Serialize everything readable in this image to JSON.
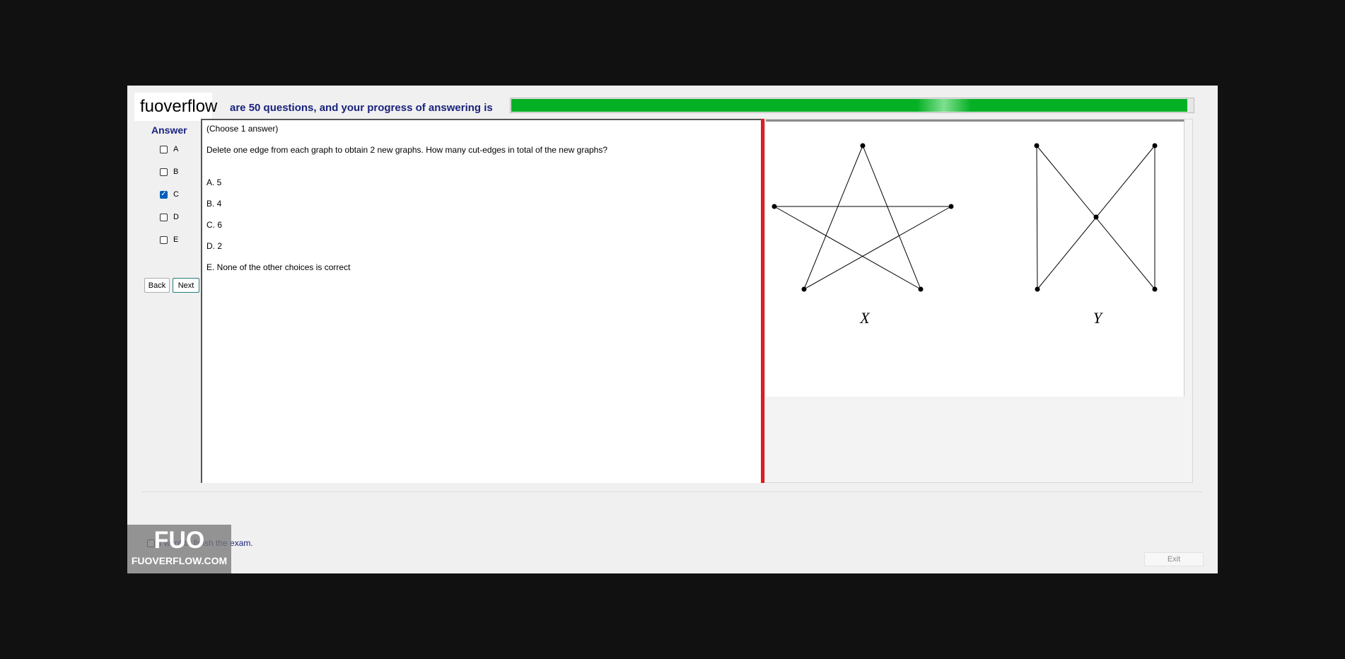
{
  "brand": {
    "logo_text": "fuoverflow"
  },
  "header": {
    "progress_text": "are 50 questions, and your progress of answering is",
    "progress_fraction": 0.99
  },
  "answer_panel": {
    "title": "Answer",
    "choices": [
      {
        "label": "A",
        "checked": false
      },
      {
        "label": "B",
        "checked": false
      },
      {
        "label": "C",
        "checked": true
      },
      {
        "label": "D",
        "checked": false
      },
      {
        "label": "E",
        "checked": false
      }
    ],
    "back_label": "Back",
    "next_label": "Next"
  },
  "question": {
    "instruction": "(Choose 1 answer)",
    "text": "Delete one edge from each graph to obtain 2 new graphs. How many cut-edges in total of the new graphs?",
    "options": [
      "A.  5",
      "B.  4",
      "C.  6",
      "D.  2",
      "E.  None of the other choices is correct"
    ]
  },
  "figure": {
    "graph_x_label": "X",
    "graph_y_label": "Y"
  },
  "footer": {
    "finish_label": "I want to finish the exam.",
    "finish_checked": false,
    "exit_label": "Exit"
  },
  "watermark": {
    "big": "FUO",
    "small": "FUOVERFLOW.COM"
  },
  "colors": {
    "accent": "#1a237e",
    "progress": "#06b025",
    "divider": "#e21c1c",
    "checked": "#005fb8"
  }
}
